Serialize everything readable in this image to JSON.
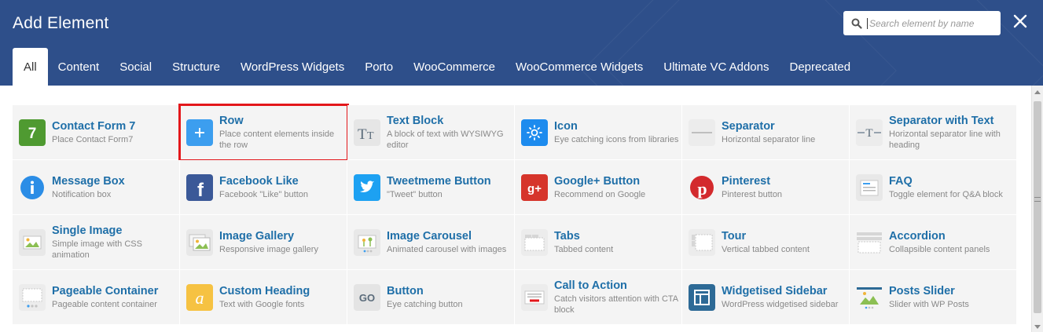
{
  "header": {
    "title": "Add Element",
    "search_placeholder": "Search element by name",
    "close_label": "×"
  },
  "tabs": [
    {
      "label": "All",
      "active": true
    },
    {
      "label": "Content"
    },
    {
      "label": "Social"
    },
    {
      "label": "Structure"
    },
    {
      "label": "WordPress Widgets"
    },
    {
      "label": "Porto"
    },
    {
      "label": "WooCommerce"
    },
    {
      "label": "WooCommerce Widgets"
    },
    {
      "label": "Ultimate VC Addons"
    },
    {
      "label": "Deprecated"
    }
  ],
  "elements": [
    {
      "name": "Contact Form 7",
      "desc": "Place Contact Form7",
      "icon": "contact-form-icon"
    },
    {
      "name": "Row",
      "desc": "Place content elements inside the row",
      "icon": "plus-icon",
      "highlighted": true
    },
    {
      "name": "Text Block",
      "desc": "A block of text with WYSIWYG editor",
      "icon": "text-block-icon"
    },
    {
      "name": "Icon",
      "desc": "Eye catching icons from libraries",
      "icon": "sun-icon"
    },
    {
      "name": "Separator",
      "desc": "Horizontal separator line",
      "icon": "separator-icon"
    },
    {
      "name": "Separator with Text",
      "desc": "Horizontal separator line with heading",
      "icon": "separator-text-icon"
    },
    {
      "name": "Message Box",
      "desc": "Notification box",
      "icon": "info-icon"
    },
    {
      "name": "Facebook Like",
      "desc": "Facebook \"Like\" button",
      "icon": "facebook-icon"
    },
    {
      "name": "Tweetmeme Button",
      "desc": "\"Tweet\" button",
      "icon": "twitter-icon"
    },
    {
      "name": "Google+ Button",
      "desc": "Recommend on Google",
      "icon": "google-plus-icon"
    },
    {
      "name": "Pinterest",
      "desc": "Pinterest button",
      "icon": "pinterest-icon"
    },
    {
      "name": "FAQ",
      "desc": "Toggle element for Q&A block",
      "icon": "faq-icon"
    },
    {
      "name": "Single Image",
      "desc": "Simple image with CSS animation",
      "icon": "image-icon"
    },
    {
      "name": "Image Gallery",
      "desc": "Responsive image gallery",
      "icon": "gallery-icon"
    },
    {
      "name": "Image Carousel",
      "desc": "Animated carousel with images",
      "icon": "carousel-icon"
    },
    {
      "name": "Tabs",
      "desc": "Tabbed content",
      "icon": "tabs-icon"
    },
    {
      "name": "Tour",
      "desc": "Vertical tabbed content",
      "icon": "tour-icon"
    },
    {
      "name": "Accordion",
      "desc": "Collapsible content panels",
      "icon": "accordion-icon"
    },
    {
      "name": "Pageable Container",
      "desc": "Pageable content container",
      "icon": "pageable-icon"
    },
    {
      "name": "Custom Heading",
      "desc": "Text with Google fonts",
      "icon": "custom-heading-icon"
    },
    {
      "name": "Button",
      "desc": "Eye catching button",
      "icon": "button-icon"
    },
    {
      "name": "Call to Action",
      "desc": "Catch visitors attention with CTA block",
      "icon": "cta-icon"
    },
    {
      "name": "Widgetised Sidebar",
      "desc": "WordPress widgetised sidebar",
      "icon": "sidebar-icon"
    },
    {
      "name": "Posts Slider",
      "desc": "Slider with WP Posts",
      "icon": "posts-slider-icon"
    }
  ],
  "colors": {
    "header_bg": "#2e4f8a",
    "element_name": "#1f6fa8",
    "highlight": "#e3171b"
  }
}
